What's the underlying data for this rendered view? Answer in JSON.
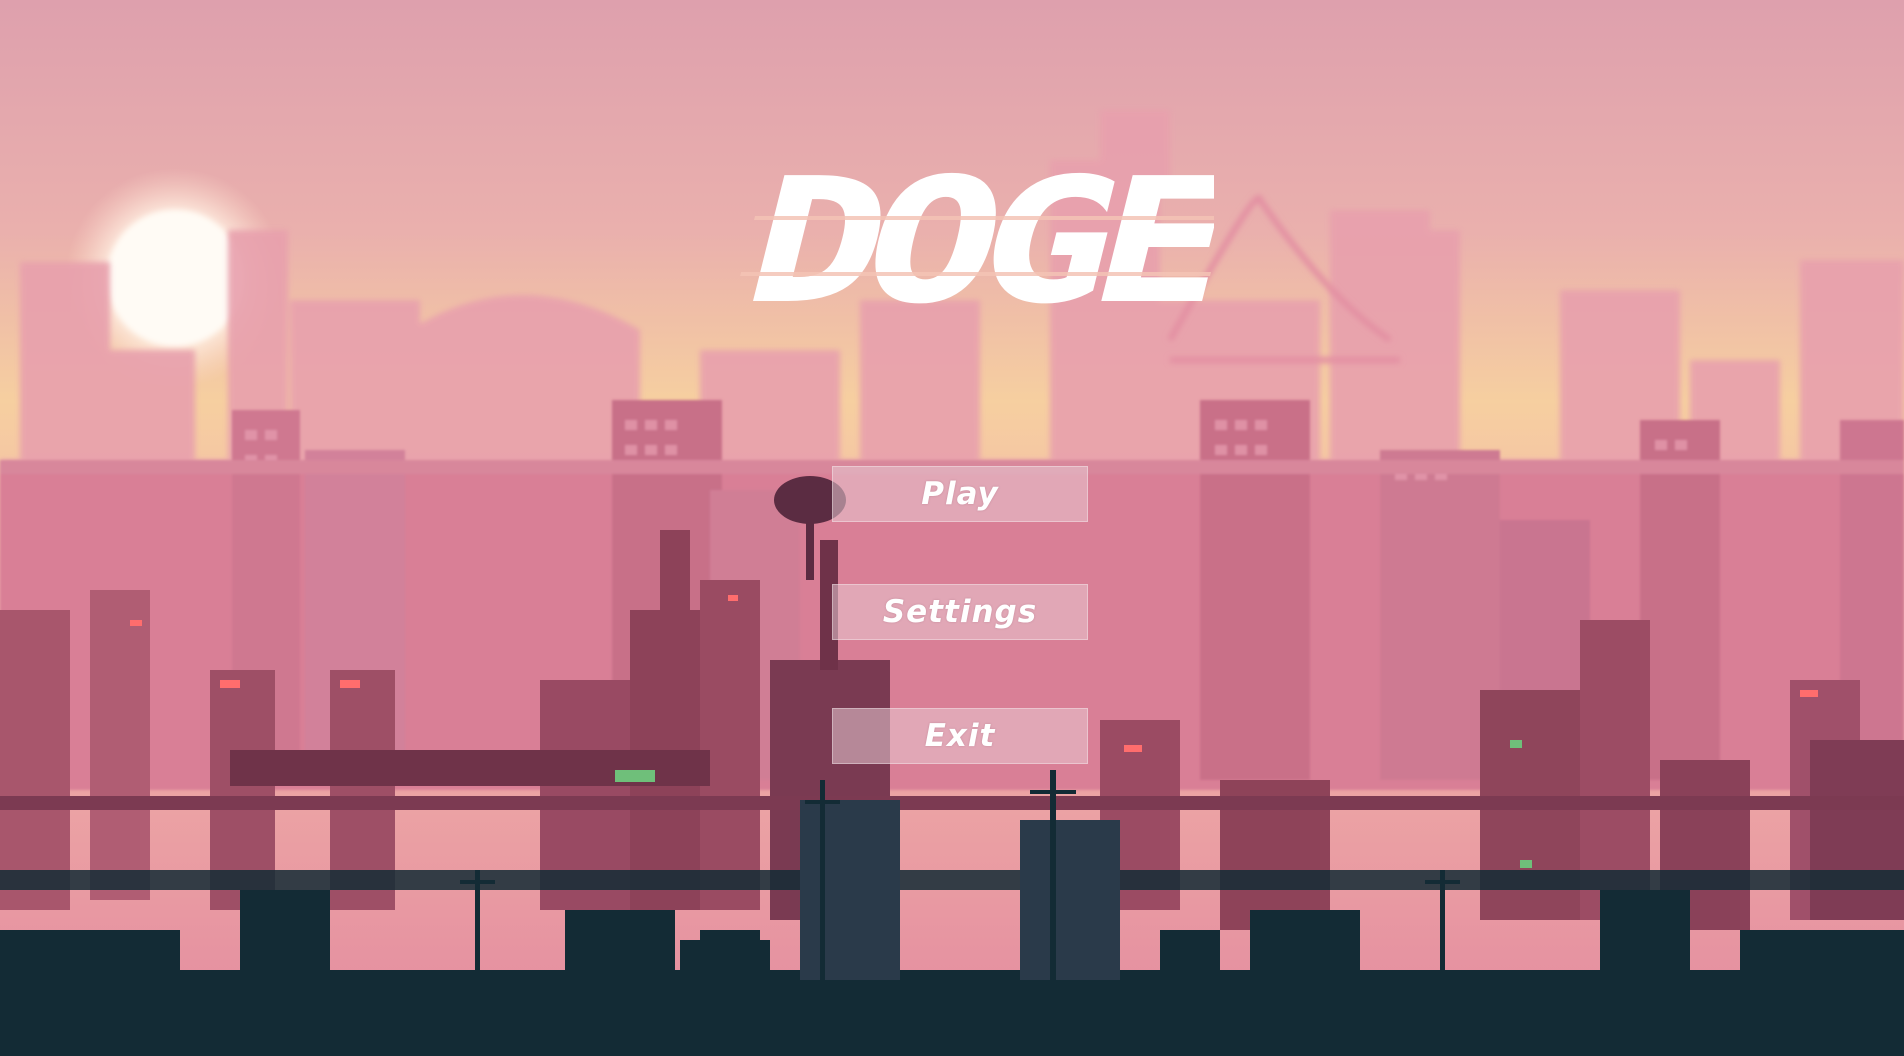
{
  "game": {
    "title": "DOGE"
  },
  "menu": {
    "play_label": "Play",
    "settings_label": "Settings",
    "exit_label": "Exit"
  },
  "colors": {
    "sky_top": "#e2a3ae",
    "sky_horizon": "#f6cf9f",
    "far_city": "#e596a6",
    "mid_city": "#d27790",
    "near_city": "#9d4f66",
    "foreground": "#132b35",
    "button_fill": "#e8c8d2",
    "title_text": "#ffffff"
  },
  "icons": {
    "sun": "sun-icon"
  }
}
